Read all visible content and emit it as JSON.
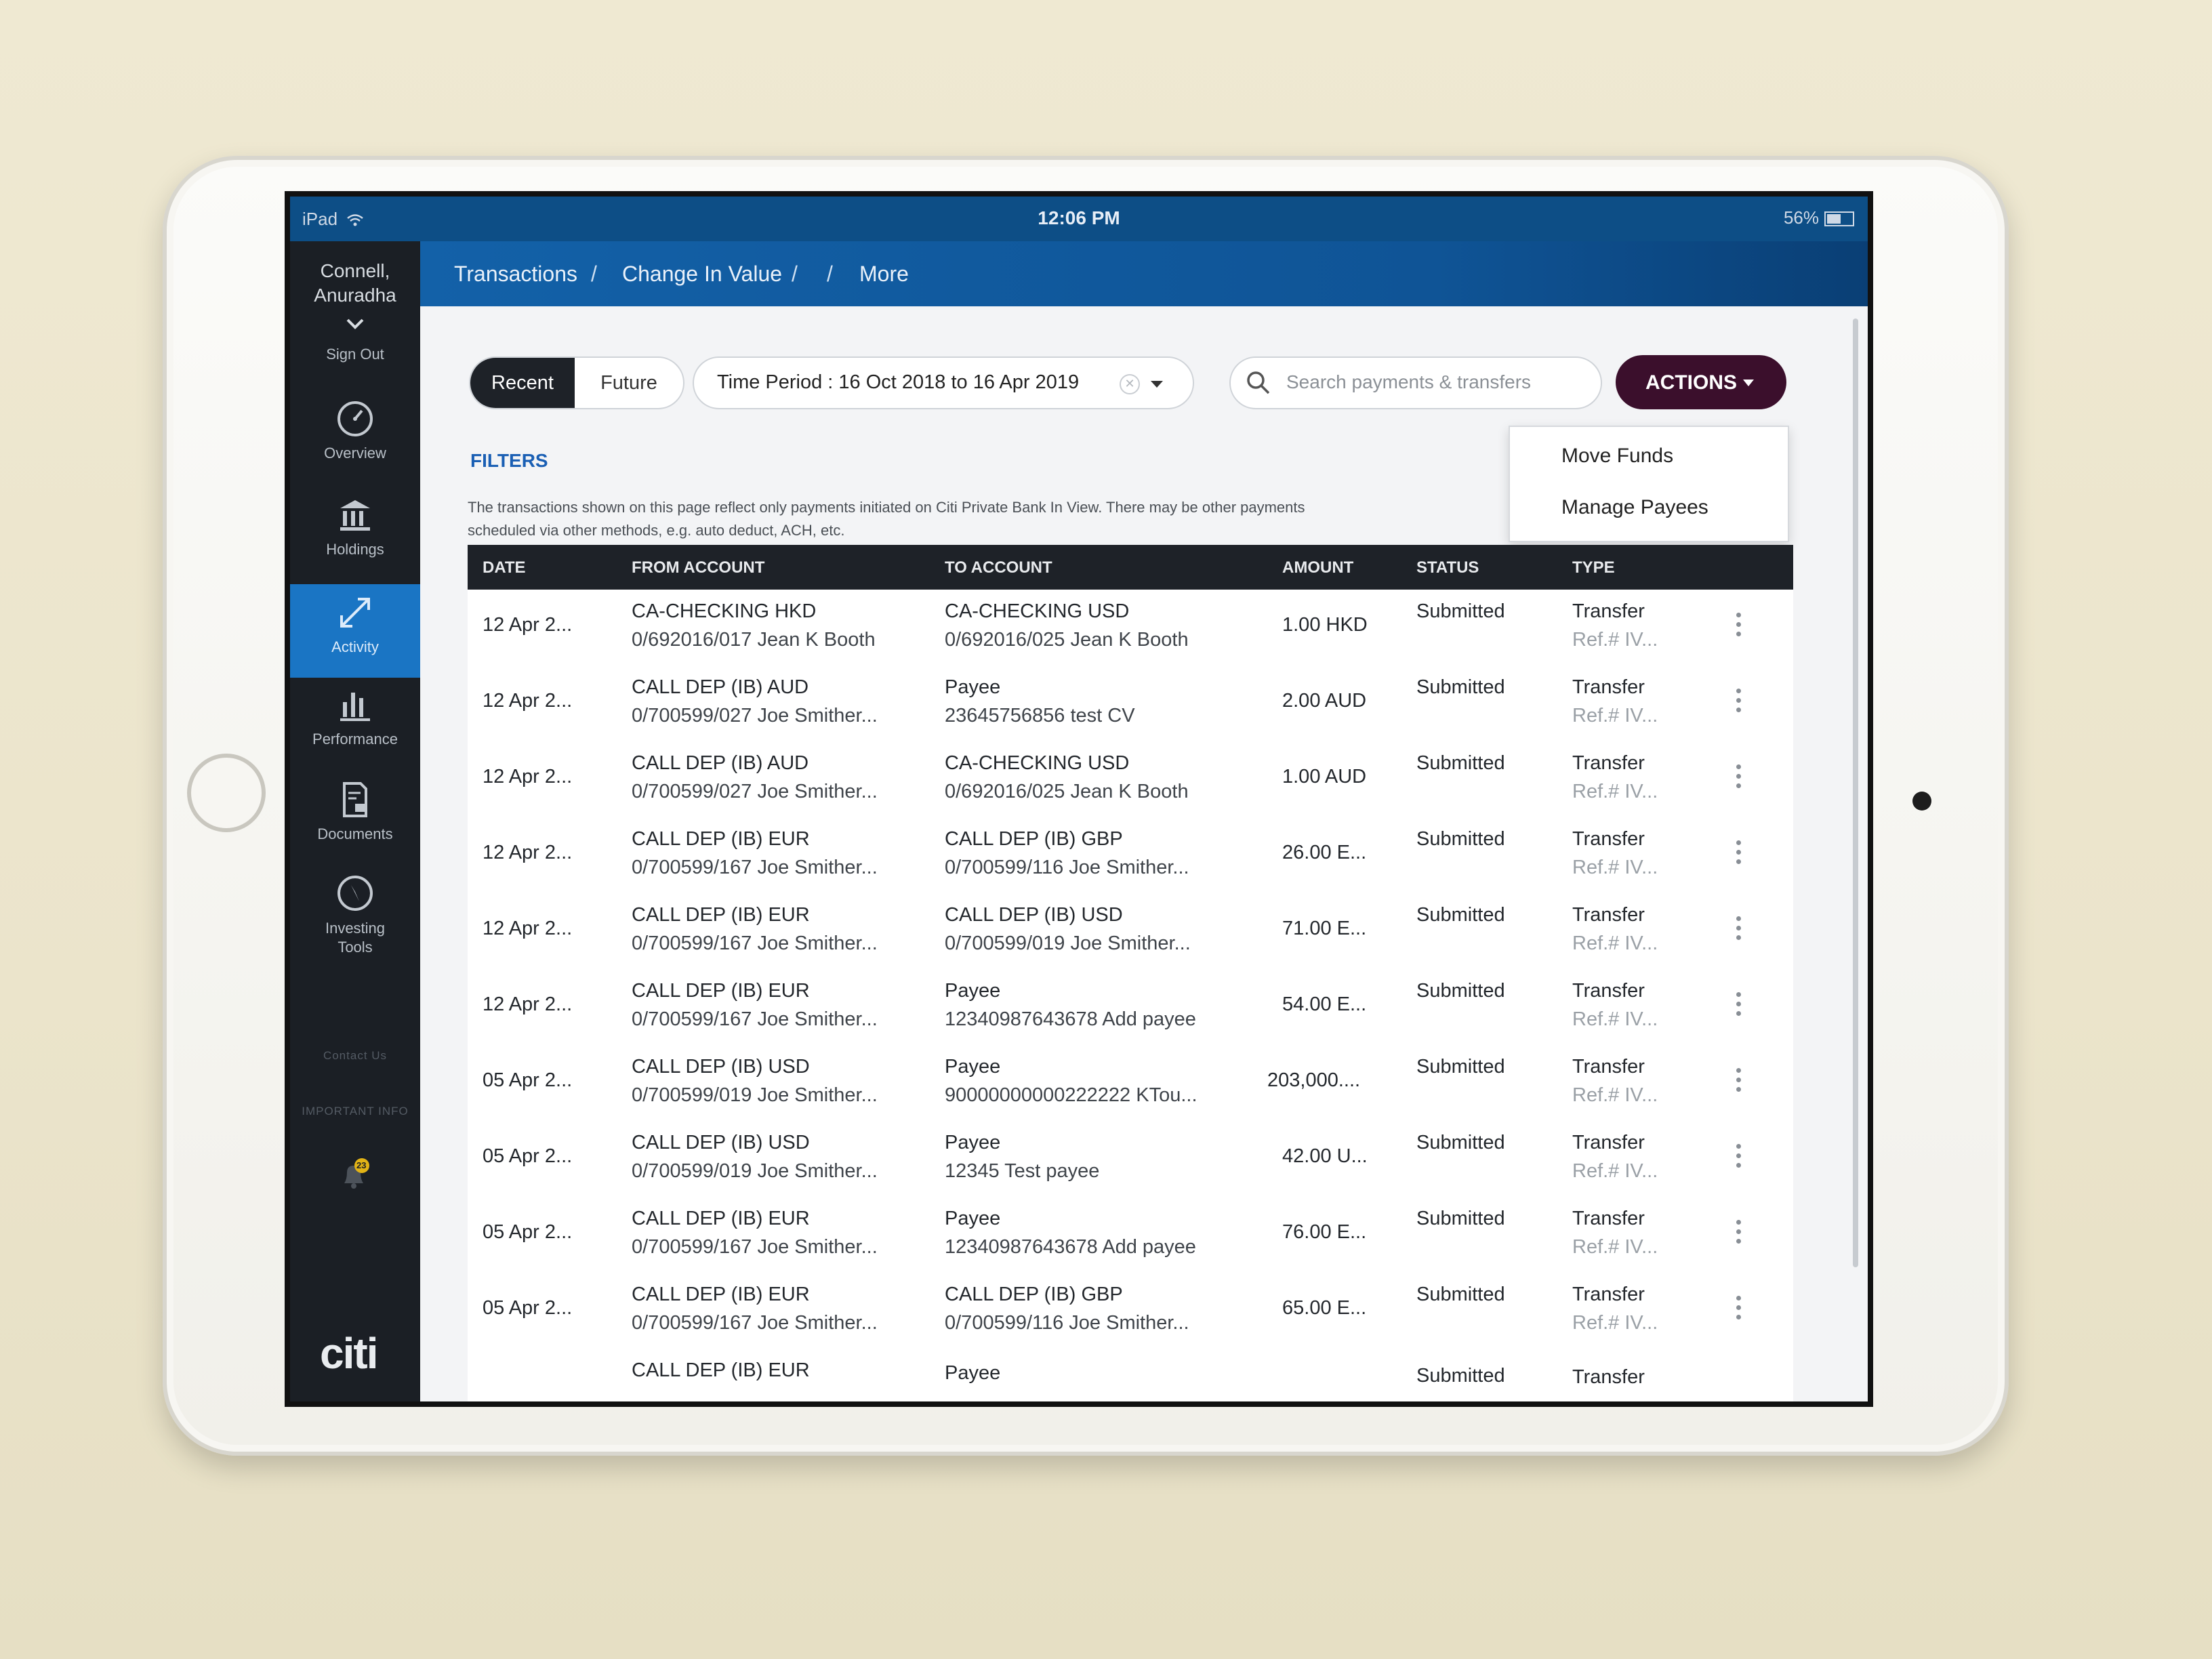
{
  "status_bar": {
    "device": "iPad",
    "time": "12:06 PM",
    "battery": "56%"
  },
  "sidebar": {
    "user_name_line1": "Connell,",
    "user_name_line2": "Anuradha",
    "sign_out": "Sign Out",
    "items": [
      {
        "label": "Overview",
        "icon": "gauge-icon"
      },
      {
        "label": "Holdings",
        "icon": "bank-icon"
      },
      {
        "label": "Activity",
        "icon": "arrows-icon",
        "active": true
      },
      {
        "label": "Performance",
        "icon": "bar-chart-icon"
      },
      {
        "label": "Documents",
        "icon": "document-lock-icon"
      },
      {
        "label_line1": "Investing",
        "label_line2": "Tools",
        "icon": "compass-icon"
      }
    ],
    "contact_us": "Contact Us",
    "important_info": "IMPORTANT INFO",
    "notification_count": "23",
    "logo": "citi"
  },
  "breadcrumb": {
    "item1": "Transactions",
    "item2": "Change In Value",
    "item3": "More",
    "separator": "/"
  },
  "toolbar": {
    "tab_recent": "Recent",
    "tab_future": "Future",
    "time_period": "Time Period : 16 Oct 2018 to 16 Apr 2019",
    "search_placeholder": "Search payments & transfers",
    "actions_label": "ACTIONS"
  },
  "actions_menu": {
    "move_funds": "Move Funds",
    "manage_payees": "Manage Payees"
  },
  "filters_label": "FILTERS",
  "notice_line1": "The transactions shown on this page reflect only payments initiated on Citi Private Bank In View. There may be other payments",
  "notice_line2": "scheduled via other methods, e.g. auto deduct, ACH, etc.",
  "table": {
    "headers": {
      "date": "DATE",
      "from": "FROM ACCOUNT",
      "to": "TO ACCOUNT",
      "amount": "AMOUNT",
      "status": "STATUS",
      "type": "TYPE"
    },
    "rows": [
      {
        "date": "12 Apr 2...",
        "from1": "CA-CHECKING HKD",
        "from2": "0/692016/017 Jean K Booth",
        "to1": "CA-CHECKING USD",
        "to2": "0/692016/025 Jean K Booth",
        "amount": "1.00 HKD",
        "status": "Submitted",
        "type": "Transfer",
        "ref": "Ref.# IV..."
      },
      {
        "date": "12 Apr 2...",
        "from1": "CALL DEP (IB) AUD",
        "from2": "0/700599/027 Joe Smither...",
        "to1": "Payee",
        "to2": "23645756856 test CV",
        "amount": "2.00 AUD",
        "status": "Submitted",
        "type": "Transfer",
        "ref": "Ref.# IV..."
      },
      {
        "date": "12 Apr 2...",
        "from1": "CALL DEP (IB) AUD",
        "from2": "0/700599/027 Joe Smither...",
        "to1": "CA-CHECKING USD",
        "to2": "0/692016/025 Jean K Booth",
        "amount": "1.00 AUD",
        "status": "Submitted",
        "type": "Transfer",
        "ref": "Ref.# IV..."
      },
      {
        "date": "12 Apr 2...",
        "from1": "CALL DEP (IB) EUR",
        "from2": "0/700599/167 Joe Smither...",
        "to1": "CALL DEP (IB) GBP",
        "to2": "0/700599/116 Joe Smither...",
        "amount": "26.00 E...",
        "status": "Submitted",
        "type": "Transfer",
        "ref": "Ref.# IV..."
      },
      {
        "date": "12 Apr 2...",
        "from1": "CALL DEP (IB) EUR",
        "from2": "0/700599/167 Joe Smither...",
        "to1": "CALL DEP (IB) USD",
        "to2": "0/700599/019 Joe Smither...",
        "amount": "71.00 E...",
        "status": "Submitted",
        "type": "Transfer",
        "ref": "Ref.# IV..."
      },
      {
        "date": "12 Apr 2...",
        "from1": "CALL DEP (IB) EUR",
        "from2": "0/700599/167 Joe Smither...",
        "to1": "Payee",
        "to2": "12340987643678 Add payee",
        "amount": "54.00 E...",
        "status": "Submitted",
        "type": "Transfer",
        "ref": "Ref.# IV..."
      },
      {
        "date": "05 Apr 2...",
        "from1": "CALL DEP (IB) USD",
        "from2": "0/700599/019 Joe Smither...",
        "to1": "Payee",
        "to2": "90000000000222222 KTou...",
        "amount": "203,000....",
        "status": "Submitted",
        "type": "Transfer",
        "ref": "Ref.# IV..."
      },
      {
        "date": "05 Apr 2...",
        "from1": "CALL DEP (IB) USD",
        "from2": "0/700599/019 Joe Smither...",
        "to1": "Payee",
        "to2": "12345 Test payee",
        "amount": "42.00 U...",
        "status": "Submitted",
        "type": "Transfer",
        "ref": "Ref.# IV..."
      },
      {
        "date": "05 Apr 2...",
        "from1": "CALL DEP (IB) EUR",
        "from2": "0/700599/167 Joe Smither...",
        "to1": "Payee",
        "to2": "12340987643678 Add payee",
        "amount": "76.00 E...",
        "status": "Submitted",
        "type": "Transfer",
        "ref": "Ref.# IV..."
      },
      {
        "date": "05 Apr 2...",
        "from1": "CALL DEP (IB) EUR",
        "from2": "0/700599/167 Joe Smither...",
        "to1": "CALL DEP (IB) GBP",
        "to2": "0/700599/116 Joe Smither...",
        "amount": "65.00 E...",
        "status": "Submitted",
        "type": "Transfer",
        "ref": "Ref.# IV..."
      },
      {
        "date": "",
        "from1": "CALL DEP (IB) EUR",
        "from2": "",
        "to1": "Payee",
        "to2": "",
        "amount": "",
        "status": "Submitted",
        "type": "Transfer",
        "ref": ""
      }
    ]
  },
  "colors": {
    "accent_blue": "#1a75c4",
    "header_blue": "#1361a8",
    "actions_button": "#3b0f2c",
    "sidebar_bg": "#1b1f25",
    "table_header_bg": "#1e2228"
  }
}
